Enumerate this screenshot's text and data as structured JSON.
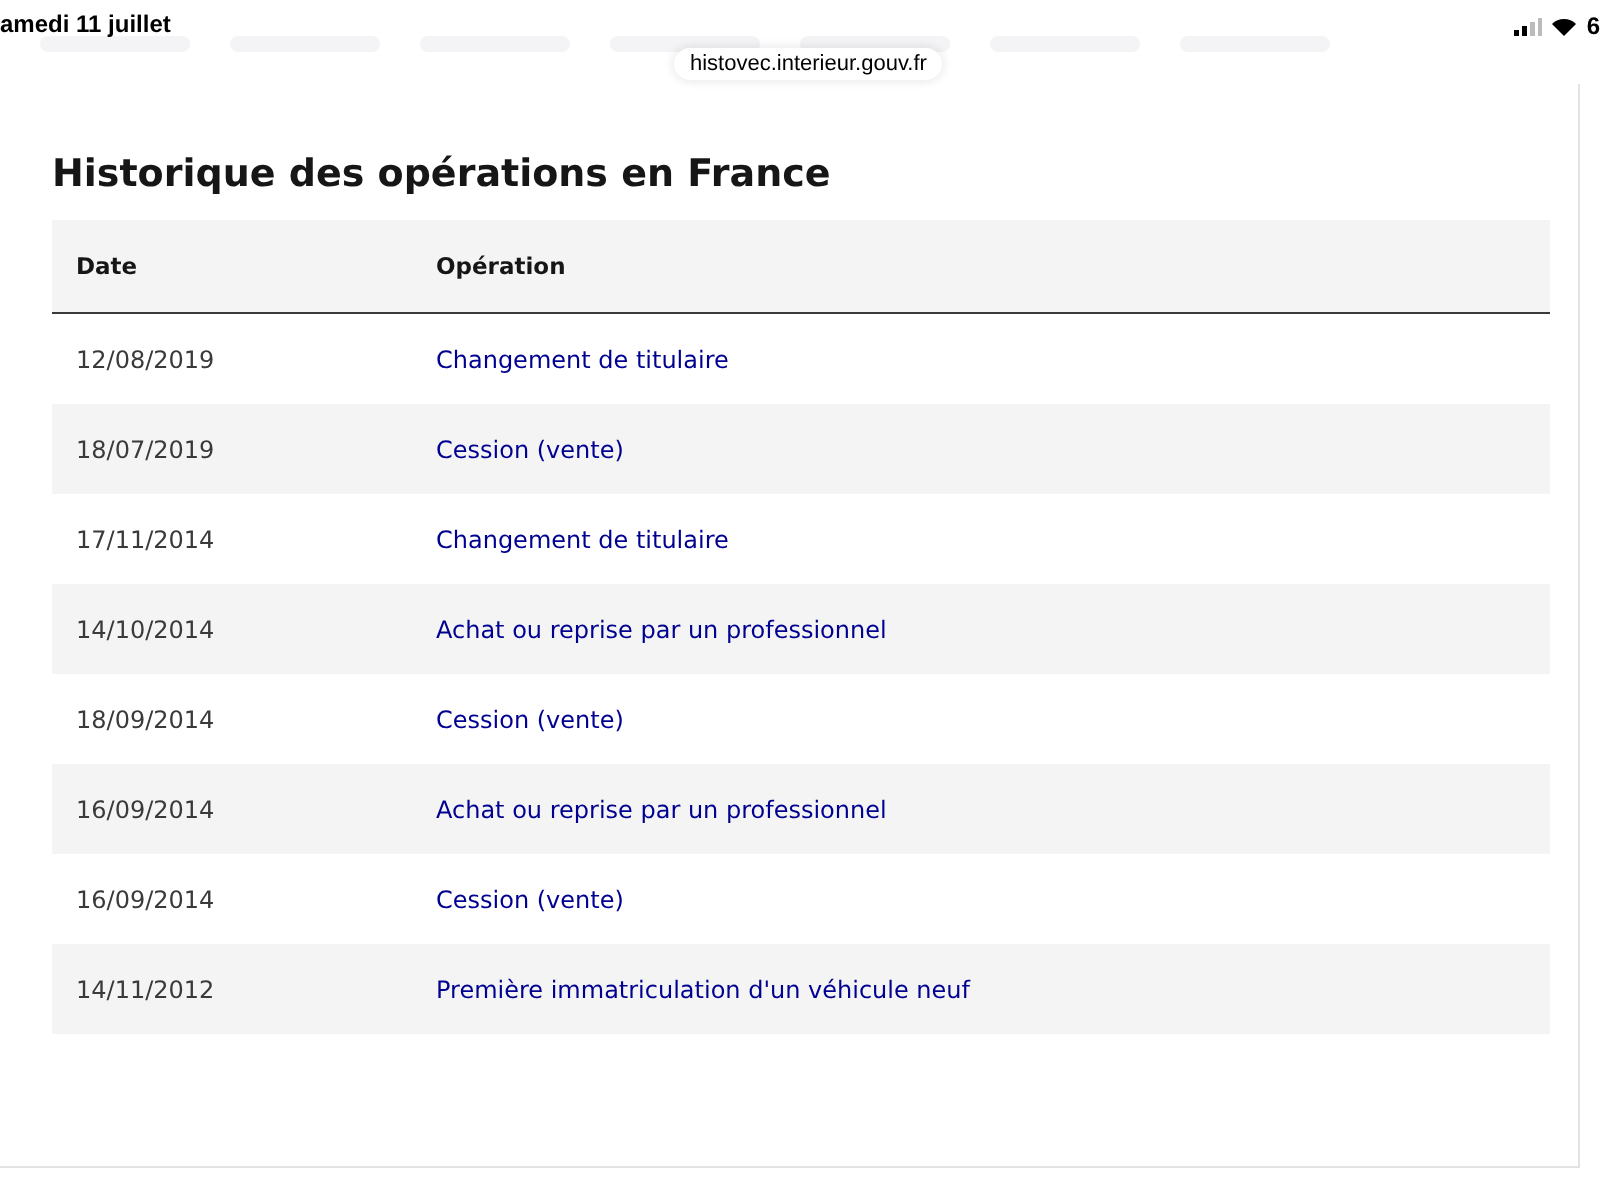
{
  "status_bar": {
    "date": "amedi 11 juillet",
    "battery": "6"
  },
  "address_bar": {
    "url": "histovec.interieur.gouv.fr"
  },
  "section": {
    "title": "Historique des opérations en France",
    "table": {
      "columns": [
        "Date",
        "Opération"
      ],
      "rows": [
        {
          "date": "12/08/2019",
          "operation": "Changement de titulaire"
        },
        {
          "date": "18/07/2019",
          "operation": "Cession (vente)"
        },
        {
          "date": "17/11/2014",
          "operation": "Changement de titulaire"
        },
        {
          "date": "14/10/2014",
          "operation": "Achat ou reprise par un professionnel"
        },
        {
          "date": "18/09/2014",
          "operation": "Cession (vente)"
        },
        {
          "date": "16/09/2014",
          "operation": "Achat ou reprise par un professionnel"
        },
        {
          "date": "16/09/2014",
          "operation": "Cession (vente)"
        },
        {
          "date": "14/11/2012",
          "operation": "Première immatriculation d'un véhicule neuf"
        }
      ]
    }
  }
}
